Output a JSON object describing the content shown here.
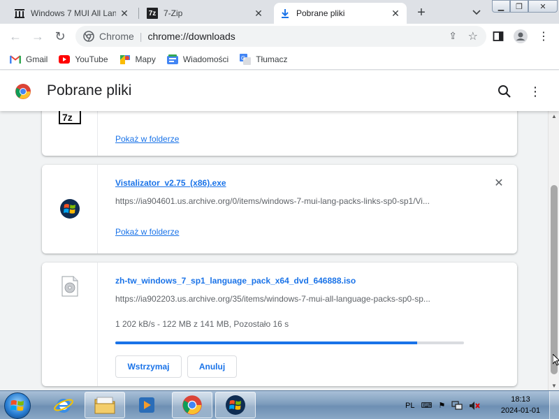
{
  "tabs": [
    {
      "title": "Windows 7 MUI All Lang",
      "favicon": "archive-icon",
      "active": false
    },
    {
      "title": "7-Zip",
      "favicon": "7zip-icon",
      "active": false
    },
    {
      "title": "Pobrane pliki",
      "favicon": "download-icon",
      "active": true
    }
  ],
  "omnibox": {
    "chip": "Chrome",
    "url": "chrome://downloads"
  },
  "bookmarks": [
    {
      "label": "Gmail",
      "icon": "gmail-icon"
    },
    {
      "label": "YouTube",
      "icon": "youtube-icon"
    },
    {
      "label": "Mapy",
      "icon": "maps-icon"
    },
    {
      "label": "Wiadomości",
      "icon": "news-icon"
    },
    {
      "label": "Tłumacz",
      "icon": "translate-icon"
    }
  ],
  "page": {
    "title": "Pobrane pliki"
  },
  "downloads": [
    {
      "icon": "7zip-icon",
      "show_in_folder": "Pokaż w folderze"
    },
    {
      "icon": "windows-logo-icon",
      "filename": "Vistalizator_v2.75_(x86).exe",
      "url": "https://ia904601.us.archive.org/0/items/windows-7-mui-lang-packs-links-sp0-sp1/Vi...",
      "show_in_folder": "Pokaż w folderze"
    },
    {
      "icon": "disc-image-icon",
      "filename": "zh-tw_windows_7_sp1_language_pack_x64_dvd_646888.iso",
      "url": "https://ia902203.us.archive.org/35/items/windows-7-mui-all-language-packs-sp0-sp...",
      "status": "1 202 kB/s - 122 MB z 141 MB, Pozostało 16 s",
      "progress_fraction": 0.865,
      "pause_label": "Wstrzymaj",
      "cancel_label": "Anuluj"
    }
  ],
  "taskbar": {
    "language": "PL",
    "time": "18:13",
    "date": "2024-01-01"
  },
  "colors": {
    "accent": "#1a73e8",
    "tabstrip": "#dee1e6",
    "page_bg": "#f1f3f4"
  }
}
